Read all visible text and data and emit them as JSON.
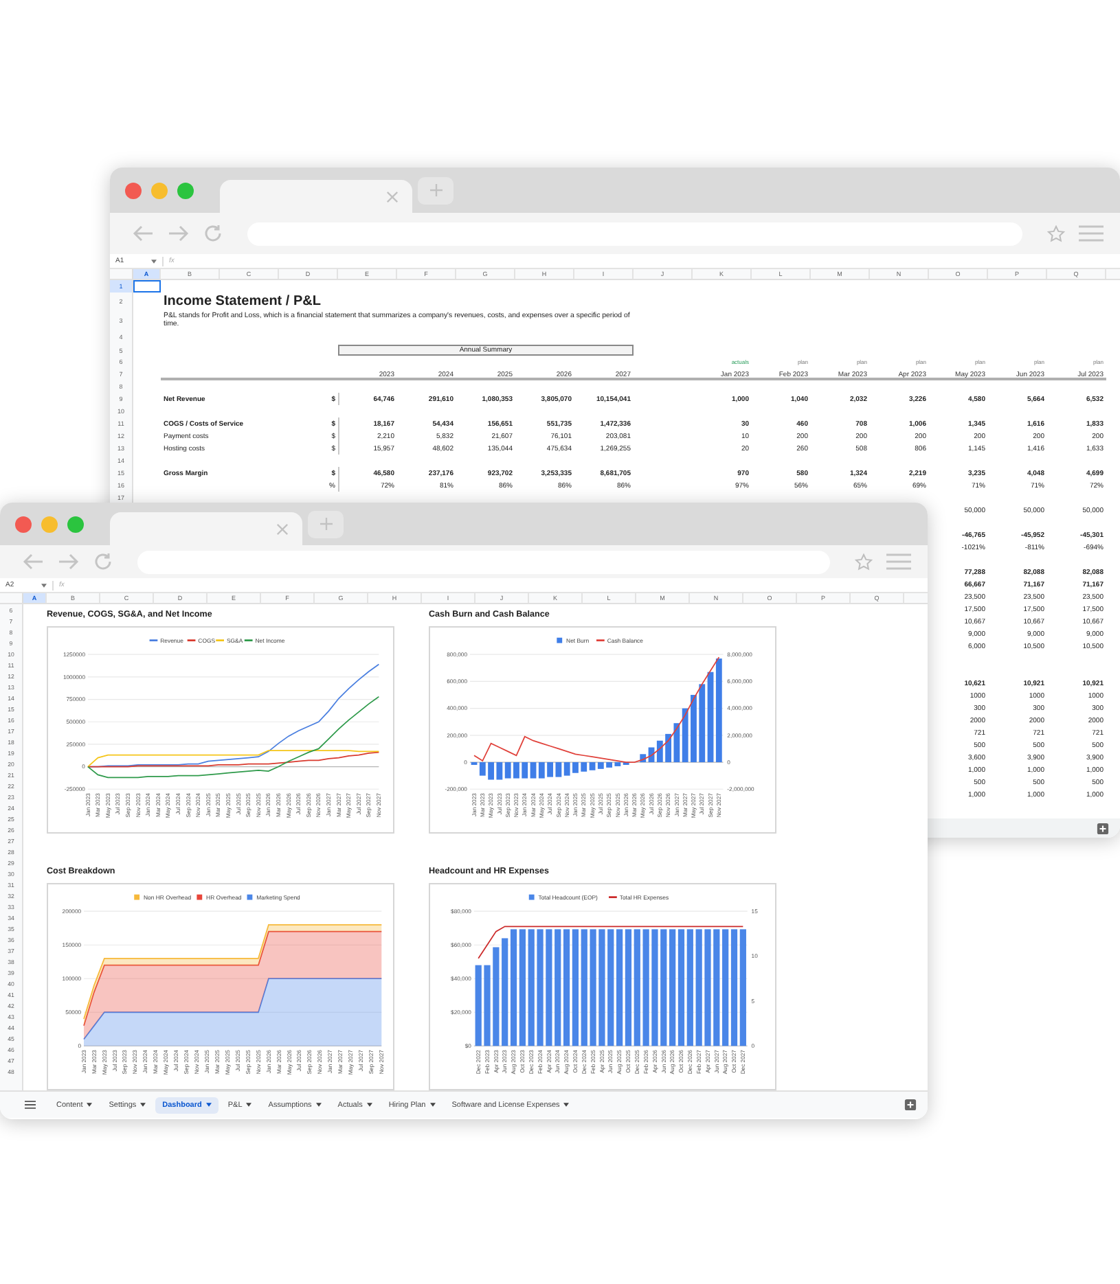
{
  "back_window": {
    "name_box": "A1",
    "formula_icon": "fx",
    "columns": [
      {
        "label": "A",
        "selected": true
      },
      {
        "label": "B",
        "selected": false
      },
      {
        "label": "C",
        "selected": false
      },
      {
        "label": "D",
        "selected": false
      },
      {
        "label": "E",
        "selected": false
      },
      {
        "label": "F",
        "selected": false
      },
      {
        "label": "G",
        "selected": false
      },
      {
        "label": "H",
        "selected": false
      },
      {
        "label": "I",
        "selected": false
      },
      {
        "label": "J",
        "selected": false
      },
      {
        "label": "K",
        "selected": false
      },
      {
        "label": "L",
        "selected": false
      },
      {
        "label": "M",
        "selected": false
      },
      {
        "label": "N",
        "selected": false
      },
      {
        "label": "O",
        "selected": false
      },
      {
        "label": "P",
        "selected": false
      },
      {
        "label": "Q",
        "selected": false
      }
    ],
    "rows": [
      {
        "number": "1",
        "selected": true,
        "kind": "blank"
      },
      {
        "number": "2",
        "selected": false,
        "kind": "title",
        "label": "Income Statement / P&L"
      },
      {
        "number": "3",
        "selected": false,
        "kind": "description",
        "label": "P&L stands for Profit and Loss, which is a financial statement that summarizes a company's revenues, costs, and expenses over a specific period of time."
      },
      {
        "number": "4",
        "selected": false,
        "kind": "blank"
      },
      {
        "number": "5",
        "selected": false,
        "kind": "band",
        "annual_title": "Annual Summary"
      },
      {
        "number": "6",
        "selected": false,
        "kind": "status",
        "monthly": [
          {
            "text": "actuals",
            "kind": "actual"
          },
          {
            "text": "plan",
            "kind": "plan"
          },
          {
            "text": "plan",
            "kind": "plan"
          },
          {
            "text": "plan",
            "kind": "plan"
          },
          {
            "text": "plan",
            "kind": "plan"
          },
          {
            "text": "plan",
            "kind": "plan"
          },
          {
            "text": "plan",
            "kind": "plan"
          }
        ]
      },
      {
        "number": "7",
        "selected": false,
        "kind": "header",
        "annual": [
          "2023",
          "2024",
          "2025",
          "2026",
          "2027"
        ],
        "monthly": [
          "Jan 2023",
          "Feb 2023",
          "Mar 2023",
          "Apr 2023",
          "May 2023",
          "Jun 2023",
          "Jul 2023"
        ]
      },
      {
        "number": "8",
        "selected": false,
        "kind": "blank"
      },
      {
        "number": "9",
        "selected": false,
        "kind": "total",
        "label": "Net Revenue",
        "unit": "$",
        "annual": [
          "64,746",
          "291,610",
          "1,080,353",
          "3,805,070",
          "10,154,041"
        ],
        "monthly": [
          "1,000",
          "1,040",
          "2,032",
          "3,226",
          "4,580",
          "5,664",
          "6,532"
        ]
      },
      {
        "number": "10",
        "selected": false,
        "kind": "blank"
      },
      {
        "number": "11",
        "selected": false,
        "kind": "total",
        "label": "COGS / Costs of Service",
        "unit": "$",
        "annual": [
          "18,167",
          "54,434",
          "156,651",
          "551,735",
          "1,472,336"
        ],
        "monthly": [
          "30",
          "460",
          "708",
          "1,006",
          "1,345",
          "1,616",
          "1,833"
        ]
      },
      {
        "number": "12",
        "selected": false,
        "kind": "item",
        "label": "Payment costs",
        "unit": "$",
        "annual": [
          "2,210",
          "5,832",
          "21,607",
          "76,101",
          "203,081"
        ],
        "monthly": [
          "10",
          "200",
          "200",
          "200",
          "200",
          "200",
          "200"
        ]
      },
      {
        "number": "13",
        "selected": false,
        "kind": "item",
        "label": "Hosting costs",
        "unit": "$",
        "annual": [
          "15,957",
          "48,602",
          "135,044",
          "475,634",
          "1,269,255"
        ],
        "monthly": [
          "20",
          "260",
          "508",
          "806",
          "1,145",
          "1,416",
          "1,633"
        ]
      },
      {
        "number": "14",
        "selected": false,
        "kind": "blank"
      },
      {
        "number": "15",
        "selected": false,
        "kind": "total",
        "label": "Gross Margin",
        "unit": "$",
        "annual": [
          "46,580",
          "237,176",
          "923,702",
          "3,253,335",
          "8,681,705"
        ],
        "monthly": [
          "970",
          "580",
          "1,324",
          "2,219",
          "3,235",
          "4,048",
          "4,699"
        ]
      },
      {
        "number": "16",
        "selected": false,
        "kind": "item",
        "unit": "%",
        "annual": [
          "72%",
          "81%",
          "86%",
          "86%",
          "86%"
        ],
        "monthly": [
          "97%",
          "56%",
          "65%",
          "69%",
          "71%",
          "71%",
          "72%"
        ]
      },
      {
        "number": "17",
        "selected": false,
        "kind": "blank"
      }
    ],
    "covered_rows": [
      {
        "kind": "item",
        "monthly": [
          "50,000",
          "50,000",
          "50,000"
        ]
      },
      {
        "kind": "blank"
      },
      {
        "kind": "total",
        "monthly": [
          "-46,765",
          "-45,952",
          "-45,301"
        ]
      },
      {
        "kind": "item",
        "monthly": [
          "-1021%",
          "-811%",
          "-694%"
        ]
      },
      {
        "kind": "blank"
      },
      {
        "kind": "total",
        "monthly": [
          "77,288",
          "82,088",
          "82,088"
        ]
      },
      {
        "kind": "total",
        "monthly": [
          "66,667",
          "71,167",
          "71,167"
        ]
      },
      {
        "kind": "item",
        "monthly": [
          "23,500",
          "23,500",
          "23,500"
        ]
      },
      {
        "kind": "item",
        "monthly": [
          "17,500",
          "17,500",
          "17,500"
        ]
      },
      {
        "kind": "item",
        "monthly": [
          "10,667",
          "10,667",
          "10,667"
        ]
      },
      {
        "kind": "item",
        "monthly": [
          "9,000",
          "9,000",
          "9,000"
        ]
      },
      {
        "kind": "item",
        "monthly": [
          "6,000",
          "10,500",
          "10,500"
        ]
      },
      {
        "kind": "blank"
      },
      {
        "kind": "blank"
      },
      {
        "kind": "total",
        "monthly": [
          "10,621",
          "10,921",
          "10,921"
        ]
      },
      {
        "kind": "item",
        "monthly": [
          "1000",
          "1000",
          "1000"
        ]
      },
      {
        "kind": "item",
        "monthly": [
          "300",
          "300",
          "300"
        ]
      },
      {
        "kind": "item",
        "monthly": [
          "2000",
          "2000",
          "2000"
        ]
      },
      {
        "kind": "item",
        "monthly": [
          "721",
          "721",
          "721"
        ]
      },
      {
        "kind": "item",
        "monthly": [
          "500",
          "500",
          "500"
        ]
      },
      {
        "kind": "item",
        "monthly": [
          "3,600",
          "3,900",
          "3,900"
        ]
      },
      {
        "kind": "item",
        "monthly": [
          "1,000",
          "1,000",
          "1,000"
        ]
      },
      {
        "kind": "item",
        "monthly": [
          "500",
          "500",
          "500"
        ]
      },
      {
        "kind": "item",
        "monthly": [
          "1,000",
          "1,000",
          "1,000"
        ]
      }
    ]
  },
  "front_window": {
    "name_box": "A2",
    "formula_icon": "fx",
    "columns": [
      {
        "label": "A",
        "selected": true
      },
      {
        "label": "B",
        "selected": false
      },
      {
        "label": "C",
        "selected": false
      },
      {
        "label": "D",
        "selected": false
      },
      {
        "label": "E",
        "selected": false
      },
      {
        "label": "F",
        "selected": false
      },
      {
        "label": "G",
        "selected": false
      },
      {
        "label": "H",
        "selected": false
      },
      {
        "label": "I",
        "selected": false
      },
      {
        "label": "J",
        "selected": false
      },
      {
        "label": "K",
        "selected": false
      },
      {
        "label": "L",
        "selected": false
      },
      {
        "label": "M",
        "selected": false
      },
      {
        "label": "N",
        "selected": false
      },
      {
        "label": "O",
        "selected": false
      },
      {
        "label": "P",
        "selected": false
      },
      {
        "label": "Q",
        "selected": false
      }
    ],
    "row_numbers": [
      "6",
      "7",
      "8",
      "9",
      "10",
      "11",
      "12",
      "13",
      "14",
      "15",
      "16",
      "17",
      "18",
      "19",
      "20",
      "21",
      "22",
      "23",
      "24",
      "25",
      "26",
      "27",
      "28",
      "29",
      "30",
      "31",
      "32",
      "33",
      "34",
      "35",
      "36",
      "37",
      "38",
      "39",
      "40",
      "41",
      "42",
      "43",
      "44",
      "45",
      "46",
      "47",
      "48"
    ],
    "charts": [
      {
        "title": "Revenue, COGS, SG&A, and Net Income",
        "chart_data": {
          "type": "line",
          "grid": true,
          "legend": "top",
          "categories": [
            "Jan 2023",
            "Mar 2023",
            "May 2023",
            "Jul 2023",
            "Sep 2023",
            "Nov 2023",
            "Jan 2024",
            "Mar 2024",
            "May 2024",
            "Jul 2024",
            "Sep 2024",
            "Nov 2024",
            "Jan 2025",
            "Mar 2025",
            "May 2025",
            "Jul 2025",
            "Sep 2025",
            "Nov 2025",
            "Jan 2026",
            "Mar 2026",
            "May 2026",
            "Jul 2026",
            "Sep 2026",
            "Nov 2026",
            "Jan 2027",
            "Mar 2027",
            "May 2027",
            "Jul 2027",
            "Sep 2027",
            "Nov 2027"
          ],
          "ylim": [
            -250000,
            1250000
          ],
          "yticks": [
            -250000,
            0,
            250000,
            500000,
            750000,
            1000000,
            1250000
          ],
          "series": [
            {
              "name": "Revenue",
              "color": "#4a7fe0",
              "values": [
                0,
                0,
                10000,
                10000,
                10000,
                20000,
                20000,
                20000,
                20000,
                20000,
                30000,
                30000,
                60000,
                70000,
                80000,
                90000,
                100000,
                110000,
                170000,
                260000,
                340000,
                400000,
                450000,
                500000,
                620000,
                760000,
                870000,
                970000,
                1060000,
                1140000
              ]
            },
            {
              "name": "COGS",
              "color": "#d93a2e",
              "values": [
                0,
                0,
                0,
                0,
                0,
                10000,
                10000,
                10000,
                10000,
                10000,
                10000,
                10000,
                10000,
                20000,
                20000,
                20000,
                30000,
                30000,
                30000,
                40000,
                50000,
                60000,
                70000,
                70000,
                90000,
                100000,
                120000,
                130000,
                150000,
                160000
              ]
            },
            {
              "name": "SG&A",
              "color": "#f5c518",
              "values": [
                0,
                100000,
                130000,
                130000,
                130000,
                130000,
                130000,
                130000,
                130000,
                130000,
                130000,
                130000,
                130000,
                130000,
                130000,
                130000,
                130000,
                130000,
                180000,
                180000,
                180000,
                180000,
                180000,
                180000,
                180000,
                180000,
                180000,
                170000,
                170000,
                170000
              ]
            },
            {
              "name": "Net Income",
              "color": "#2e9a4a",
              "values": [
                0,
                -90000,
                -120000,
                -120000,
                -120000,
                -120000,
                -110000,
                -110000,
                -110000,
                -100000,
                -100000,
                -100000,
                -90000,
                -80000,
                -70000,
                -60000,
                -50000,
                -40000,
                -50000,
                0,
                60000,
                110000,
                160000,
                200000,
                310000,
                420000,
                520000,
                610000,
                700000,
                780000
              ]
            }
          ]
        }
      },
      {
        "title": "Cash Burn and Cash Balance",
        "chart_data": {
          "type": "bar",
          "grid": true,
          "legend": "top",
          "categories": [
            "Jan 2023",
            "Mar 2023",
            "May 2023",
            "Jul 2023",
            "Sep 2023",
            "Nov 2023",
            "Jan 2024",
            "Mar 2024",
            "May 2024",
            "Jul 2024",
            "Sep 2024",
            "Nov 2024",
            "Jan 2025",
            "Mar 2025",
            "May 2025",
            "Jul 2025",
            "Sep 2025",
            "Nov 2025",
            "Jan 2026",
            "Mar 2026",
            "May 2026",
            "Jul 2026",
            "Sep 2026",
            "Nov 2026",
            "Jan 2027",
            "Mar 2027",
            "May 2027",
            "Jul 2027",
            "Sep 2027",
            "Nov 2027"
          ],
          "ylim": [
            -200000,
            800000
          ],
          "yticks": [
            {
              "value": -200000,
              "label": "-200,000"
            },
            0,
            {
              "value": 200000,
              "label": "200,000"
            },
            {
              "value": 400000,
              "label": "400,000"
            },
            {
              "value": 600000,
              "label": "600,000"
            },
            {
              "value": 800000,
              "label": "800,000"
            }
          ],
          "y2lim": [
            -2000000,
            8000000
          ],
          "y2ticks": [
            {
              "value": -2000000,
              "label": "-2,000,000"
            },
            0,
            {
              "value": 2000000,
              "label": "2,000,000"
            },
            {
              "value": 4000000,
              "label": "4,000,000"
            },
            {
              "value": 6000000,
              "label": "6,000,000"
            },
            {
              "value": 8000000,
              "label": "8,000,000"
            }
          ],
          "series": [
            {
              "name": "Net Burn",
              "color": "#3f7ee8",
              "type": "bar",
              "values": [
                -20000,
                -100000,
                -130000,
                -130000,
                -120000,
                -120000,
                -120000,
                -120000,
                -120000,
                -110000,
                -110000,
                -100000,
                -80000,
                -70000,
                -60000,
                -50000,
                -40000,
                -30000,
                -20000,
                null,
                60000,
                110000,
                160000,
                210000,
                290000,
                400000,
                500000,
                580000,
                670000,
                770000
              ]
            },
            {
              "name": "Cash Balance",
              "color": "#e0413a",
              "type": "line",
              "axis": "y2",
              "values": [
                500000,
                100000,
                1400000,
                1100000,
                800000,
                500000,
                1900000,
                1600000,
                1400000,
                1200000,
                1000000,
                800000,
                600000,
                500000,
                400000,
                300000,
                200000,
                100000,
                0,
                0,
                200000,
                500000,
                1000000,
                1600000,
                2500000,
                3500000,
                4700000,
                5800000,
                6800000,
                7800000
              ]
            }
          ]
        }
      },
      {
        "title": "Cost Breakdown",
        "chart_data": {
          "type": "area",
          "stacked": true,
          "grid": true,
          "legend": "top",
          "categories": [
            "Jan 2023",
            "Mar 2023",
            "May 2023",
            "Jul 2023",
            "Sep 2023",
            "Nov 2023",
            "Jan 2024",
            "Mar 2024",
            "May 2024",
            "Jul 2024",
            "Sep 2024",
            "Nov 2024",
            "Jan 2025",
            "Mar 2025",
            "May 2025",
            "Jul 2025",
            "Sep 2025",
            "Nov 2025",
            "Jan 2026",
            "Mar 2026",
            "May 2026",
            "Jul 2026",
            "Sep 2026",
            "Nov 2026",
            "Jan 2027",
            "Mar 2027",
            "May 2027",
            "Jul 2027",
            "Sep 2027",
            "Nov 2027"
          ],
          "ylim": [
            0,
            200000
          ],
          "yticks": [
            0,
            50000,
            100000,
            150000,
            200000
          ],
          "series": [
            {
              "name": "Non HR Overhead",
              "color": "#f6b93b",
              "values": [
                10000,
                10000,
                10000,
                10000,
                10000,
                10000,
                10000,
                10000,
                10000,
                10000,
                10000,
                10000,
                10000,
                10000,
                10000,
                10000,
                10000,
                10000,
                10000,
                10000,
                10000,
                10000,
                10000,
                10000,
                10000,
                10000,
                10000,
                10000,
                10000,
                10000
              ]
            },
            {
              "name": "HR Overhead",
              "color": "#e8463a",
              "values": [
                20000,
                50000,
                70000,
                70000,
                70000,
                70000,
                70000,
                70000,
                70000,
                70000,
                70000,
                70000,
                70000,
                70000,
                70000,
                70000,
                70000,
                70000,
                70000,
                70000,
                70000,
                70000,
                70000,
                70000,
                70000,
                70000,
                70000,
                70000,
                70000,
                70000
              ]
            },
            {
              "name": "Marketing Spend",
              "color": "#4b86e8",
              "values": [
                10000,
                30000,
                50000,
                50000,
                50000,
                50000,
                50000,
                50000,
                50000,
                50000,
                50000,
                50000,
                50000,
                50000,
                50000,
                50000,
                50000,
                50000,
                100000,
                100000,
                100000,
                100000,
                100000,
                100000,
                100000,
                100000,
                100000,
                100000,
                100000,
                100000
              ]
            }
          ]
        }
      },
      {
        "title": "Headcount and HR Expenses",
        "chart_data": {
          "type": "bar",
          "grid": true,
          "legend": "top",
          "categories": [
            "Dec 2022",
            "Feb 2023",
            "Apr 2023",
            "Jun 2023",
            "Aug 2023",
            "Oct 2023",
            "Dec 2023",
            "Feb 2024",
            "Apr 2024",
            "Jun 2024",
            "Aug 2024",
            "Oct 2024",
            "Dec 2024",
            "Feb 2025",
            "Apr 2025",
            "Jun 2025",
            "Aug 2025",
            "Oct 2025",
            "Dec 2025",
            "Feb 2026",
            "Apr 2026",
            "Jun 2026",
            "Aug 2026",
            "Oct 2026",
            "Dec 2026",
            "Feb 2027",
            "Apr 2027",
            "Jun 2027",
            "Aug 2027",
            "Oct 2027",
            "Dec 2027"
          ],
          "ylim": [
            0,
            80000
          ],
          "yticks": [
            {
              "value": 0,
              "label": "$0"
            },
            {
              "value": 20000,
              "label": "$20,000"
            },
            {
              "value": 40000,
              "label": "$40,000"
            },
            {
              "value": 60000,
              "label": "$60,000"
            },
            {
              "value": 80000,
              "label": "$80,000"
            }
          ],
          "y2lim": [
            0,
            15
          ],
          "y2ticks": [
            {
              "value": 0,
              "label": "0"
            },
            {
              "value": 5,
              "label": "5"
            },
            {
              "value": 10,
              "label": "10"
            },
            {
              "value": 15,
              "label": "15"
            }
          ],
          "series": [
            {
              "name": "Total Headcount (EOP)",
              "color": "#4a86e8",
              "type": "bar",
              "axis": "y2",
              "values": [
                9,
                9,
                11,
                12,
                13,
                13,
                13,
                13,
                13,
                13,
                13,
                13,
                13,
                13,
                13,
                13,
                13,
                13,
                13,
                13,
                13,
                13,
                13,
                13,
                13,
                13,
                13,
                13,
                13,
                13,
                13
              ]
            },
            {
              "name": "Total HR Expenses",
              "color": "#cc2b2b",
              "type": "line",
              "values": [
                52000,
                60000,
                68000,
                71000,
                71000,
                71000,
                71000,
                71000,
                71000,
                71000,
                71000,
                71000,
                71000,
                71000,
                71000,
                71000,
                71000,
                71000,
                71000,
                71000,
                71000,
                71000,
                71000,
                71000,
                71000,
                71000,
                71000,
                71000,
                71000,
                71000,
                71000
              ]
            }
          ]
        }
      }
    ],
    "sheet_tabs": [
      {
        "label": "Content",
        "selected": false
      },
      {
        "label": "Settings",
        "selected": false
      },
      {
        "label": "Dashboard",
        "selected": true
      },
      {
        "label": "P&L",
        "selected": false
      },
      {
        "label": "Assumptions",
        "selected": false
      },
      {
        "label": "Actuals",
        "selected": false
      },
      {
        "label": "Hiring Plan",
        "selected": false
      },
      {
        "label": "Software and License Expenses",
        "selected": false
      }
    ]
  }
}
